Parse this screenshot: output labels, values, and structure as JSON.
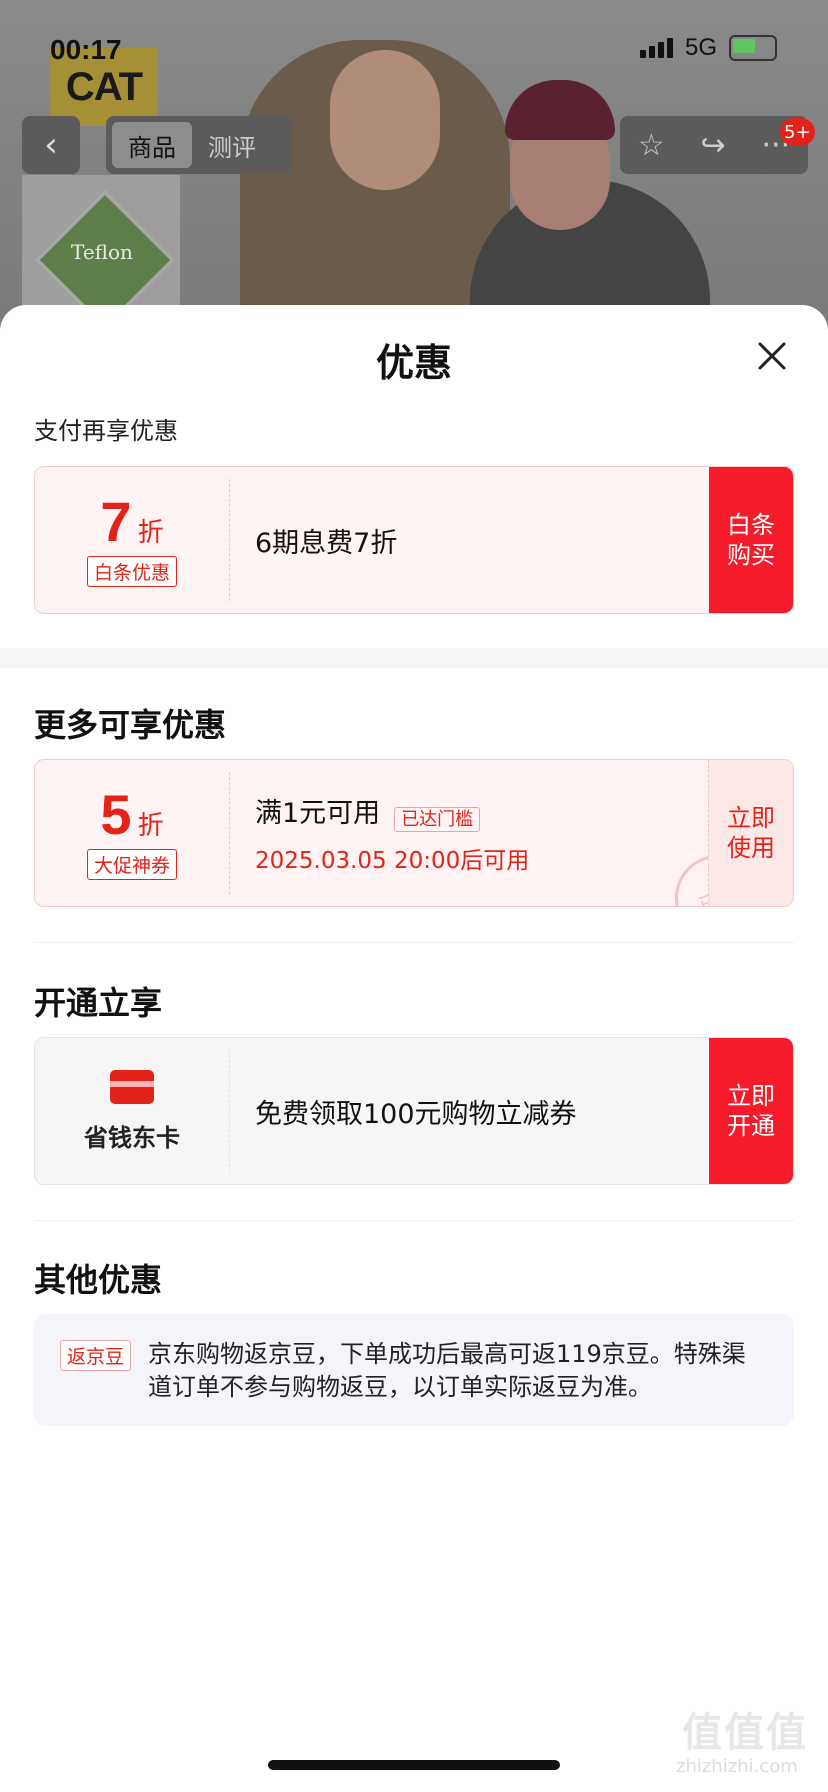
{
  "status": {
    "time": "00:17",
    "network": "5G"
  },
  "background": {
    "logo": "CAT",
    "teflon": "Teflon",
    "tabs": [
      {
        "label": "商品"
      },
      {
        "label": "测评"
      }
    ],
    "badge": "5+"
  },
  "sheet": {
    "title": "优惠",
    "pay_section": {
      "title": "支付再享优惠",
      "coupon": {
        "discount": "7",
        "unit": "折",
        "tag": "白条优惠",
        "main": "6期息费7折",
        "action_line1": "白条",
        "action_line2": "购买"
      }
    },
    "more_section": {
      "title": "更多可享优惠",
      "coupon": {
        "discount": "5",
        "unit": "折",
        "tag": "大促神券",
        "main": "满1元可用",
        "reached": "已达门槛",
        "sub": "2025.03.05 20:00后可用",
        "action_line1": "立即",
        "action_line2": "使用",
        "stamp": "已领"
      }
    },
    "open_section": {
      "title": "开通立享",
      "card": {
        "label": "省钱东卡",
        "main": "免费领取100元购物立减券",
        "action_line1": "立即",
        "action_line2": "开通"
      }
    },
    "other_section": {
      "title": "其他优惠",
      "tag": "返京豆",
      "text": "京东购物返京豆，下单成功后最高可返119京豆。特殊渠道订单不参与购物返豆，以订单实际返豆为准。"
    }
  },
  "watermark": {
    "main": "值值值",
    "sub": "zhizhizhi.com"
  },
  "colors": {
    "accent": "#e2231a",
    "action": "#f61b2a"
  }
}
